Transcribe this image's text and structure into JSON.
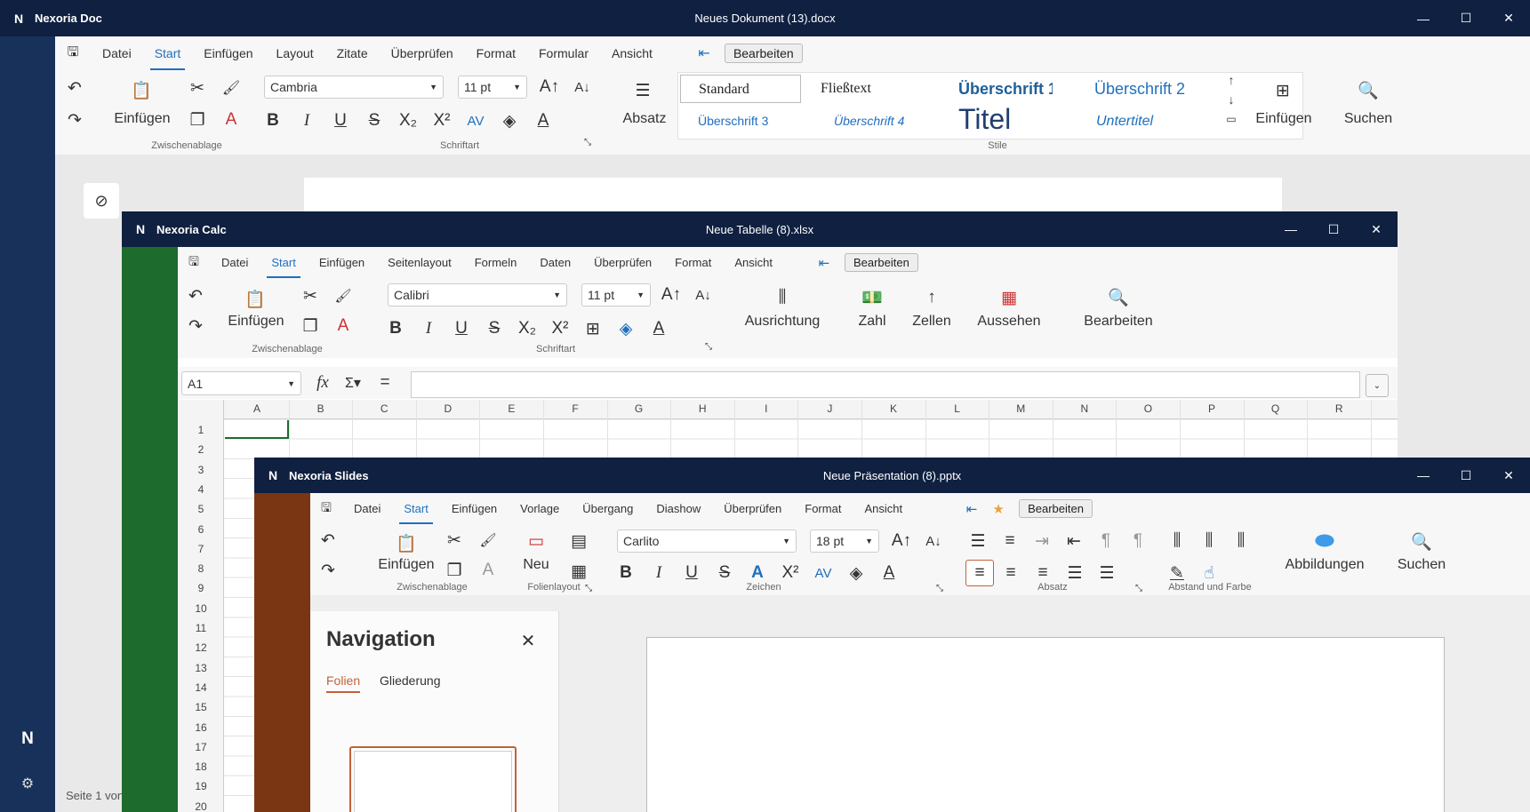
{
  "doc": {
    "app_name": "Nexoria Doc",
    "doc_title": "Neues Dokument (13).docx",
    "menu": [
      "Datei",
      "Start",
      "Einfügen",
      "Layout",
      "Zitate",
      "Überprüfen",
      "Format",
      "Formular",
      "Ansicht"
    ],
    "edit_label": "Bearbeiten",
    "font": "Cambria",
    "size": "11 pt",
    "paste_label": "Einfügen",
    "para_label": "Absatz",
    "insert_label": "Einfügen",
    "search_label": "Suchen",
    "groups": {
      "clipboard": "Zwischenablage",
      "font": "Schriftart",
      "styles": "Stile"
    },
    "styles": [
      "Standard",
      "Fließtext",
      "Überschrift 1",
      "Überschrift 2",
      "Überschrift 3",
      "Überschrift 4",
      "Titel",
      "Untertitel"
    ],
    "status": "Seite 1 von"
  },
  "calc": {
    "app_name": "Nexoria Calc",
    "doc_title": "Neue Tabelle (8).xlsx",
    "menu": [
      "Datei",
      "Start",
      "Einfügen",
      "Seitenlayout",
      "Formeln",
      "Daten",
      "Überprüfen",
      "Format",
      "Ansicht"
    ],
    "edit_label": "Bearbeiten",
    "font": "Calibri",
    "size": "11 pt",
    "paste_label": "Einfügen",
    "groups": {
      "clipboard": "Zwischenablage",
      "font": "Schriftart"
    },
    "big_buttons": [
      "Ausrichtung",
      "Zahl",
      "Zellen",
      "Aussehen",
      "Bearbeiten"
    ],
    "cell_ref": "A1",
    "columns": [
      "A",
      "B",
      "C",
      "D",
      "E",
      "F",
      "G",
      "H",
      "I",
      "J",
      "K",
      "L",
      "M",
      "N",
      "O",
      "P",
      "Q",
      "R"
    ],
    "rows": [
      "1",
      "2",
      "3",
      "4",
      "5",
      "6",
      "7",
      "8",
      "9",
      "10",
      "11",
      "12",
      "13",
      "14",
      "15",
      "16",
      "17",
      "18",
      "19",
      "20"
    ]
  },
  "slides": {
    "app_name": "Nexoria Slides",
    "doc_title": "Neue Präsentation (8).pptx",
    "menu": [
      "Datei",
      "Start",
      "Einfügen",
      "Vorlage",
      "Übergang",
      "Diashow",
      "Überprüfen",
      "Format",
      "Ansicht"
    ],
    "edit_label": "Bearbeiten",
    "font": "Carlito",
    "size": "18 pt",
    "paste_label": "Einfügen",
    "new_label": "Neu",
    "figures_label": "Abbildungen",
    "search_label": "Suchen",
    "groups": {
      "clipboard": "Zwischenablage",
      "layout": "Folienlayout",
      "chars": "Zeichen",
      "para": "Absatz",
      "spacing": "Abstand und Farbe"
    },
    "nav_title": "Navigation",
    "nav_tabs": [
      "Folien",
      "Gliederung"
    ]
  },
  "colors": {
    "titlebar": "#0f2040",
    "accent": "#1f6fbf",
    "calc_green": "#1e6b2e",
    "slides_brown": "#7a3512"
  }
}
